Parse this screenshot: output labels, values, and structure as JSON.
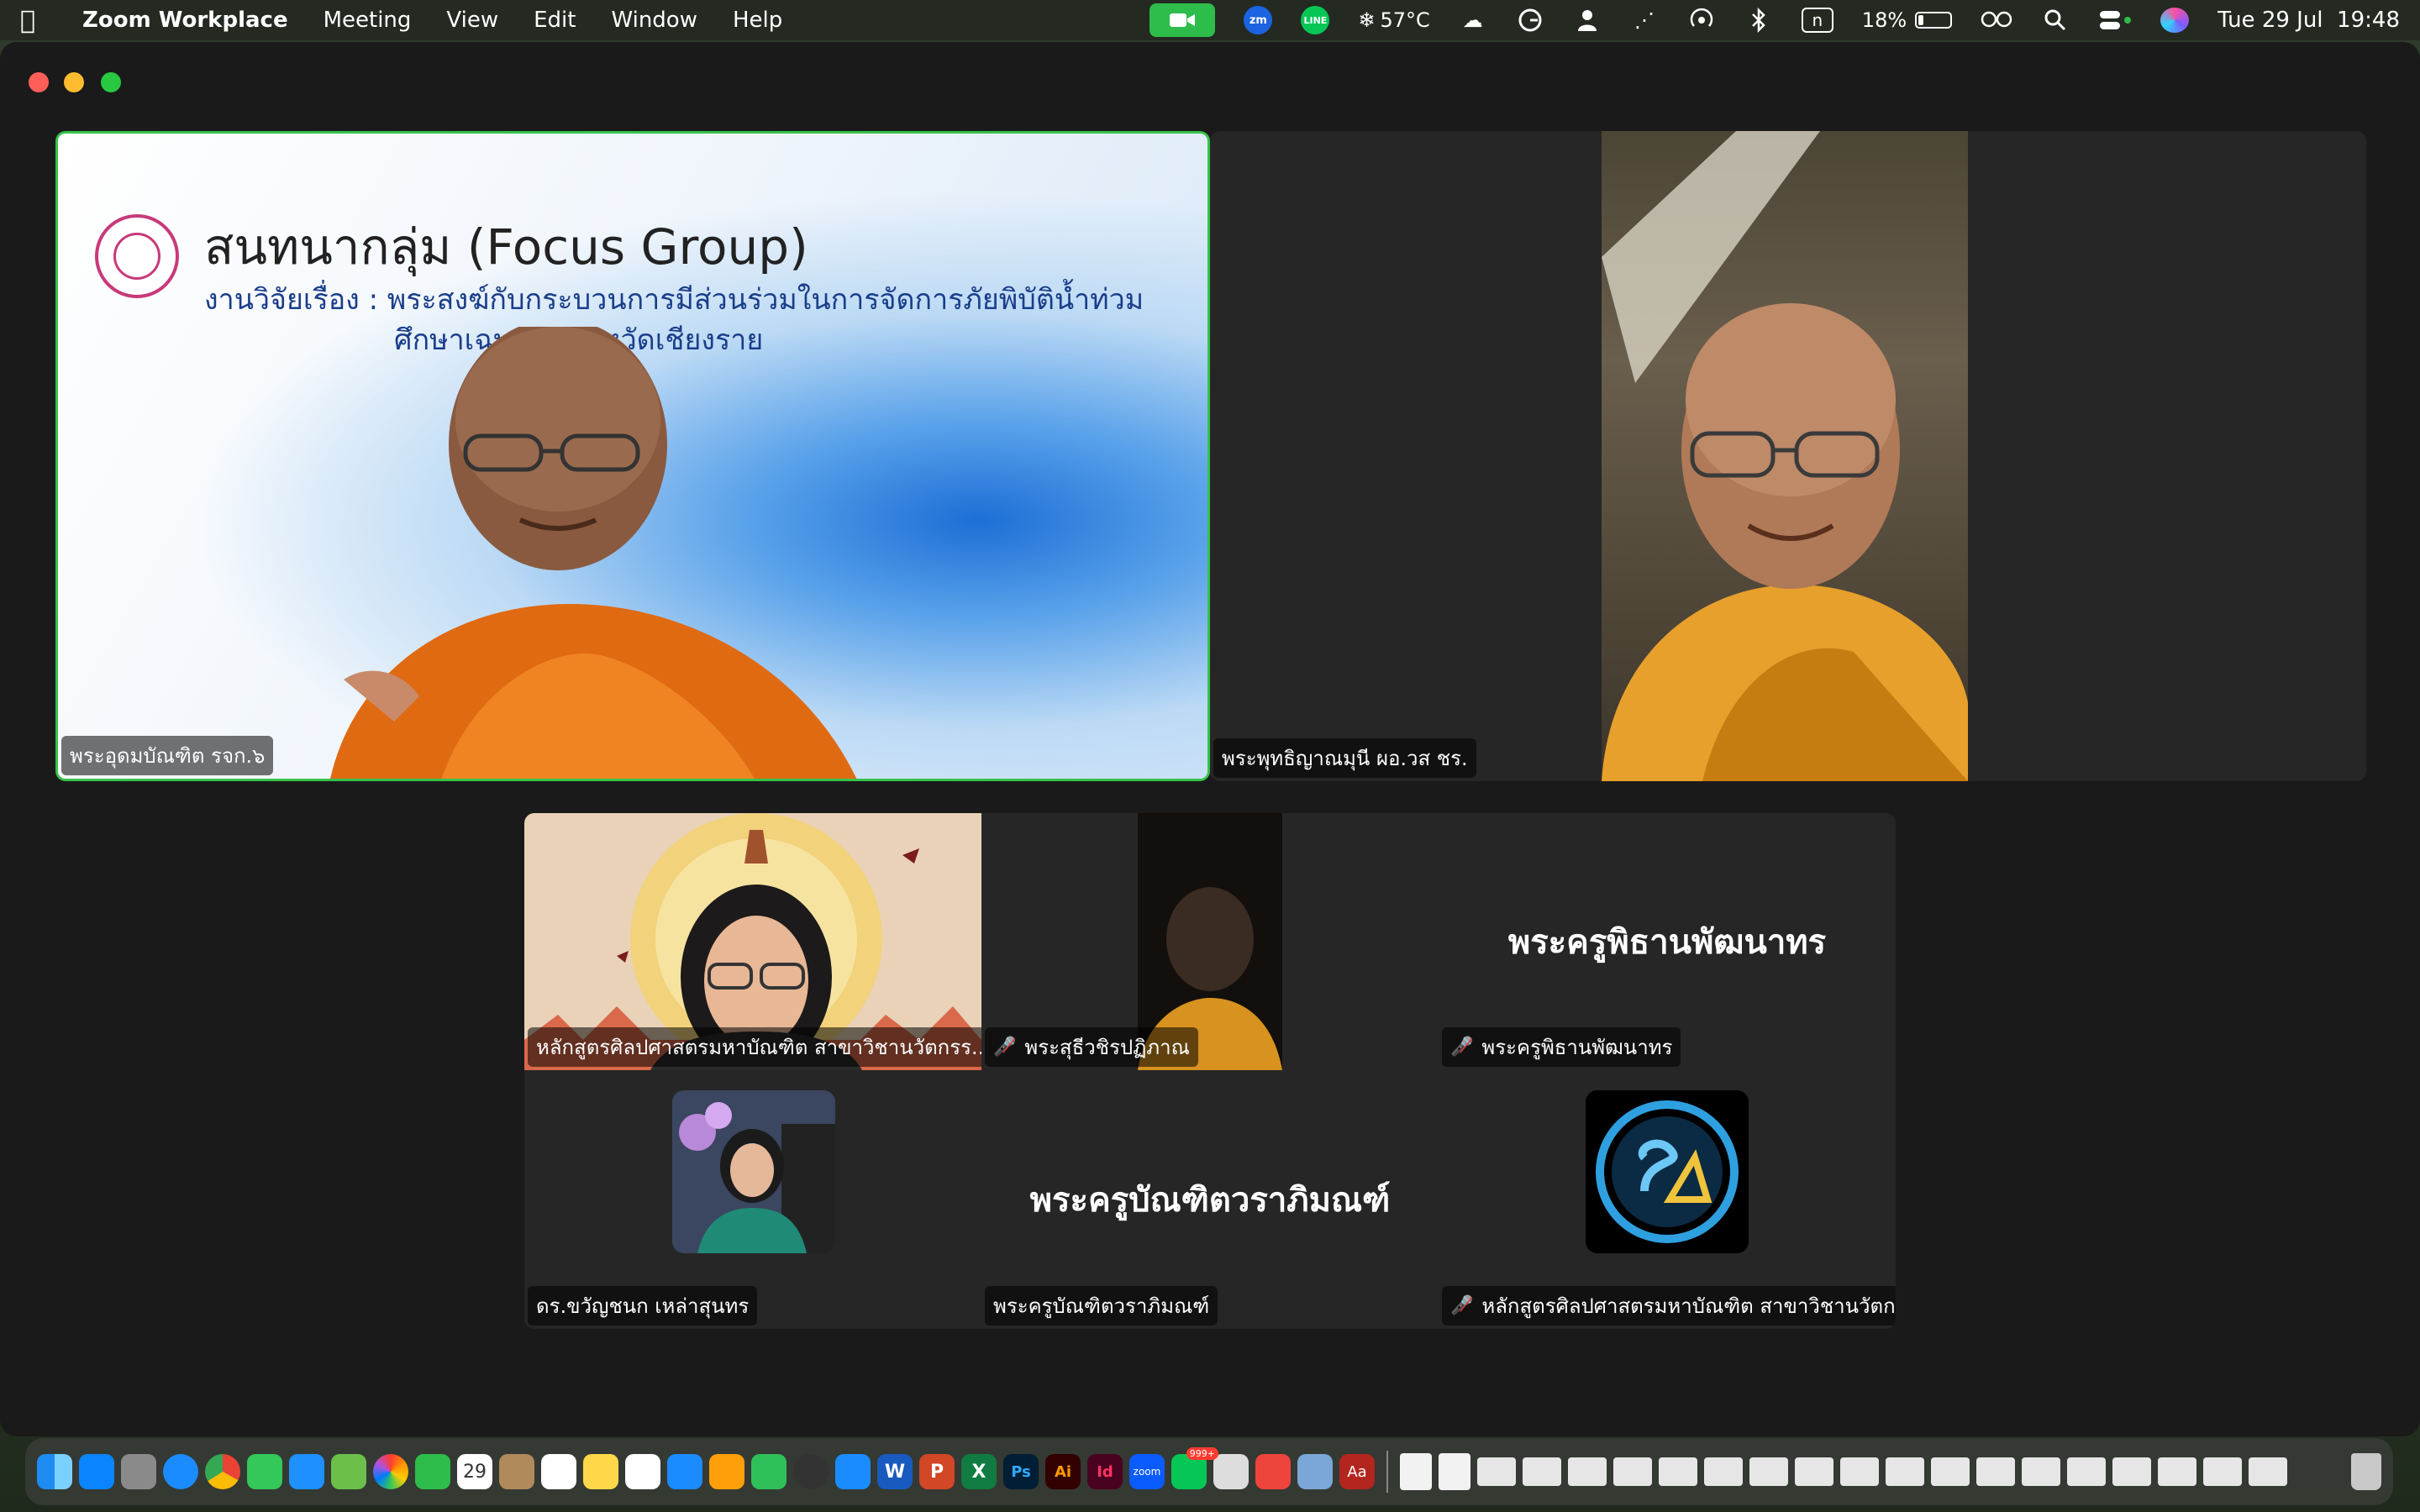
{
  "menubar": {
    "apple": "",
    "app_name": "Zoom Workplace",
    "menus": [
      "Meeting",
      "View",
      "Edit",
      "Window",
      "Help"
    ],
    "zm_label": "zm",
    "line_label": "LINE",
    "temperature": "57°C",
    "n_label": "n",
    "battery_percent": "18%",
    "battery_level": 0.18,
    "datetime": "Tue 29 Jul  19:48"
  },
  "meeting": {
    "presenter": {
      "name": "พระอุดมบัณฑิต รจก.๖",
      "slide_title": "สนทนากลุ่ม (Focus Group)",
      "slide_line1": "งานวิจัยเรื่อง : พระสงฆ์กับกระบวนการมีส่วนร่วมในการจัดการภัยพิบัติน้ำท่วม",
      "slide_line2": "ศึกษาเฉพาะ...จังหวัดเชียงราย"
    },
    "speaker2": {
      "name": "พระพุทธิญาณมุนี ผอ.วส ชร."
    },
    "grid": [
      {
        "name": "หลักสูตรศิลปศาสตรมหาบัณฑิต สาขาวิชานวัตกรร...",
        "muted": false,
        "display": ""
      },
      {
        "name": "พระสุธีวชิรปฏิภาณ",
        "muted": true,
        "display": ""
      },
      {
        "name": "พระครูพิธานพัฒนาทร",
        "muted": true,
        "display": "พระครูพิธานพัฒนาทร"
      },
      {
        "name": "ดร.ขวัญชนก เหล่าสุนทร",
        "muted": false,
        "display": ""
      },
      {
        "name": "พระครูบัณฑิตวราภิมณฑ์",
        "muted": false,
        "display": "พระครูบัณฑิตวราภิมณฑ์"
      },
      {
        "name": "หลักสูตรศิลปศาสตรมหาบัณฑิต สาขาวิชานวัตก...",
        "muted": true,
        "display": ""
      }
    ]
  },
  "dock": {
    "calendar_day": "29",
    "badge_line": "999+",
    "app_labels": {
      "word": "W",
      "powerpoint": "P",
      "excel": "X",
      "photoshop": "Ps",
      "illustrator": "Ai",
      "indesign": "Id",
      "zoom": "zoom",
      "dictionary": "Aa"
    }
  }
}
